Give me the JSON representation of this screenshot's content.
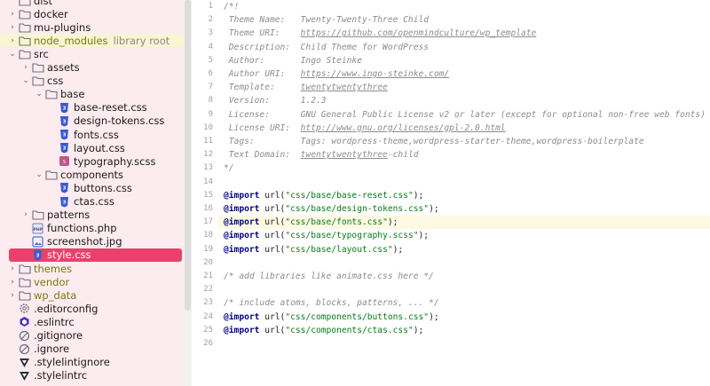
{
  "tree": [
    {
      "label": "dist",
      "icon": "folder",
      "chev": "",
      "indent": 1
    },
    {
      "label": "docker",
      "icon": "folder",
      "chev": "›",
      "indent": 1
    },
    {
      "label": "mu-plugins",
      "icon": "folder",
      "chev": "›",
      "indent": 1
    },
    {
      "label": "node_modules",
      "suffix": "library root",
      "icon": "folder",
      "chev": "›",
      "indent": 1,
      "highlight": true,
      "olive": true
    },
    {
      "label": "src",
      "icon": "folder",
      "chev": "⌄",
      "indent": 1
    },
    {
      "label": "assets",
      "icon": "folder",
      "chev": "›",
      "indent": 2
    },
    {
      "label": "css",
      "icon": "folder",
      "chev": "⌄",
      "indent": 2
    },
    {
      "label": "base",
      "icon": "folder",
      "chev": "⌄",
      "indent": 3
    },
    {
      "label": "base-reset.css",
      "icon": "css",
      "chev": "",
      "indent": 4
    },
    {
      "label": "design-tokens.css",
      "icon": "css",
      "chev": "",
      "indent": 4
    },
    {
      "label": "fonts.css",
      "icon": "css",
      "chev": "",
      "indent": 4
    },
    {
      "label": "layout.css",
      "icon": "css",
      "chev": "",
      "indent": 4
    },
    {
      "label": "typography.scss",
      "icon": "scss",
      "chev": "",
      "indent": 4
    },
    {
      "label": "components",
      "icon": "folder",
      "chev": "⌄",
      "indent": 3
    },
    {
      "label": "buttons.css",
      "icon": "css",
      "chev": "",
      "indent": 4
    },
    {
      "label": "ctas.css",
      "icon": "css",
      "chev": "",
      "indent": 4
    },
    {
      "label": "patterns",
      "icon": "folder",
      "chev": "›",
      "indent": 2
    },
    {
      "label": "functions.php",
      "icon": "php",
      "chev": "",
      "indent": 2
    },
    {
      "label": "screenshot.jpg",
      "icon": "image",
      "chev": "",
      "indent": 2
    },
    {
      "label": "style.css",
      "icon": "css",
      "chev": "",
      "indent": 2,
      "selected": true
    },
    {
      "label": "themes",
      "icon": "folder",
      "chev": "›",
      "indent": 1,
      "olive": true
    },
    {
      "label": "vendor",
      "icon": "folder",
      "chev": "›",
      "indent": 1,
      "olive": true
    },
    {
      "label": "wp_data",
      "icon": "folder",
      "chev": "›",
      "indent": 1,
      "olive": true
    },
    {
      "label": ".editorconfig",
      "icon": "gear",
      "chev": "",
      "indent": 1
    },
    {
      "label": ".eslintrc",
      "icon": "eslint",
      "chev": "",
      "indent": 1
    },
    {
      "label": ".gitignore",
      "icon": "ignore",
      "chev": "",
      "indent": 1
    },
    {
      "label": ".ignore",
      "icon": "ignore",
      "chev": "",
      "indent": 1
    },
    {
      "label": ".stylelintignore",
      "icon": "stylelint",
      "chev": "",
      "indent": 1
    },
    {
      "label": ".stylelintrc",
      "icon": "stylelint",
      "chev": "",
      "indent": 1
    }
  ],
  "line_numbers": [
    "1",
    "2",
    "3",
    "4",
    "5",
    "6",
    "7",
    "8",
    "9",
    "10",
    "11",
    "12",
    "13",
    "14",
    "15",
    "16",
    "17",
    "18",
    "19",
    "20",
    "21",
    "22",
    "23",
    "24",
    "25",
    "26"
  ],
  "code": [
    [
      {
        "t": "/*!",
        "c": "cm"
      }
    ],
    [
      {
        "t": " Theme Name:   Twenty-Twenty-Three Child",
        "c": "cm"
      }
    ],
    [
      {
        "t": " Theme URI:    ",
        "c": "cm"
      },
      {
        "t": "https://github.com/openmindculture/wp_template",
        "c": "cm-link"
      }
    ],
    [
      {
        "t": " Description:  Child Theme for WordPress",
        "c": "cm"
      }
    ],
    [
      {
        "t": " Author:       Ingo Steinke",
        "c": "cm"
      }
    ],
    [
      {
        "t": " Author URI:   ",
        "c": "cm"
      },
      {
        "t": "https://www.ingo-steinke.com/",
        "c": "cm-link"
      }
    ],
    [
      {
        "t": " Template:     ",
        "c": "cm"
      },
      {
        "t": "twentytwentythree",
        "c": "cm-link"
      }
    ],
    [
      {
        "t": " Version:      1.2.3",
        "c": "cm"
      }
    ],
    [
      {
        "t": " License:      GNU General Public License v2 or later (except for optional non-free web fonts)",
        "c": "cm"
      }
    ],
    [
      {
        "t": " License URI:  ",
        "c": "cm"
      },
      {
        "t": "http://www.gnu.org/licenses/gpl-2.0.html",
        "c": "cm-link"
      }
    ],
    [
      {
        "t": " Tags:         Tags: wordpress-theme,wordpress-starter-theme,wordpress-boilerplate",
        "c": "cm"
      }
    ],
    [
      {
        "t": " Text Domain:  ",
        "c": "cm"
      },
      {
        "t": "twentytwentythree",
        "c": "cm-link"
      },
      {
        "t": "-child",
        "c": "cm"
      }
    ],
    [
      {
        "t": "*/",
        "c": "cm"
      }
    ],
    [],
    [
      {
        "t": "@import",
        "c": "kw"
      },
      {
        "t": " url(",
        "c": "fn"
      },
      {
        "t": "\"css/base/base-reset.css\"",
        "c": "str"
      },
      {
        "t": ");",
        "c": "fn"
      }
    ],
    [
      {
        "t": "@import",
        "c": "kw"
      },
      {
        "t": " url(",
        "c": "fn"
      },
      {
        "t": "\"css/base/design-tokens.css\"",
        "c": "str"
      },
      {
        "t": ");",
        "c": "fn"
      }
    ],
    [
      {
        "t": "@import",
        "c": "kw"
      },
      {
        "t": " url(",
        "c": "fn"
      },
      {
        "t": "\"css/base/fonts.css\"",
        "c": "str"
      },
      {
        "t": ");",
        "c": "fn"
      }
    ],
    [
      {
        "t": "@import",
        "c": "kw"
      },
      {
        "t": " url(",
        "c": "fn"
      },
      {
        "t": "\"css/base/typography.scss\"",
        "c": "str"
      },
      {
        "t": ");",
        "c": "fn"
      }
    ],
    [
      {
        "t": "@import",
        "c": "kw"
      },
      {
        "t": " url(",
        "c": "fn"
      },
      {
        "t": "\"css/base/layout.css\"",
        "c": "str"
      },
      {
        "t": ");",
        "c": "fn"
      }
    ],
    [],
    [
      {
        "t": "/* add libraries like animate.css here */",
        "c": "cm"
      }
    ],
    [],
    [
      {
        "t": "/* include atoms, blocks, patterns, ... */",
        "c": "cm"
      }
    ],
    [
      {
        "t": "@import",
        "c": "kw"
      },
      {
        "t": " url(",
        "c": "fn"
      },
      {
        "t": "\"css/components/buttons.css\"",
        "c": "str"
      },
      {
        "t": ");",
        "c": "fn"
      }
    ],
    [
      {
        "t": "@import",
        "c": "kw"
      },
      {
        "t": " url(",
        "c": "fn"
      },
      {
        "t": "\"css/components/ctas.css\"",
        "c": "str"
      },
      {
        "t": ");",
        "c": "fn"
      }
    ],
    []
  ],
  "caret_line": 17,
  "colors": {
    "sidebar_bg": "#fcebef",
    "selected": "#e8426c",
    "highlight": "#f8f5d2",
    "keyword": "#000080",
    "string": "#067d17",
    "comment": "#8c8c8c"
  }
}
